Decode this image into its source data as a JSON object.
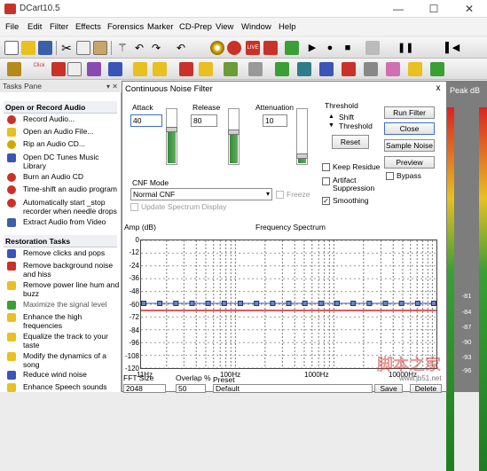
{
  "window": {
    "title": "DCart10.5",
    "minimize": "—",
    "maximize": "☐",
    "close": "✕"
  },
  "menu": [
    "File",
    "Edit",
    "Filter",
    "Effects",
    "Forensics",
    "Marker",
    "CD-Prep",
    "View",
    "Window",
    "Help"
  ],
  "toolbar1_icons": [
    "new-icon",
    "open-icon",
    "save-icon",
    "cut-icon",
    "copy-icon",
    "paste-icon",
    "wand-icon",
    "undo-icon",
    "redo-icon",
    "undo-dropdown-icon",
    "cd-icon",
    "record-icon",
    "live-icon",
    "mixer-icon",
    "marker-icon",
    "play-icon",
    "stop-icon",
    "record-dot-icon",
    "loop-icon",
    "pause-icon",
    "skip-start-icon"
  ],
  "toolbar2_icons": [
    "tools-icon",
    "click-icon",
    "filter-icon",
    "spectrum-icon",
    "analyzer-icon",
    "wave-icon",
    "eq-icon",
    "amp-icon",
    "denoise-icon",
    "reverb-icon",
    "midi-icon",
    "pan-icon",
    "normalize-icon",
    "hum-icon",
    "broadband-icon",
    "stats-icon",
    "cd-burn-icon",
    "label-icon",
    "export-icon",
    "wave2-icon"
  ],
  "colors": {
    "accent": "#3b6fc5",
    "meter_green": "#3aa035",
    "noise_line": "#e02222",
    "curve_line": "#3a55b6",
    "icon_red": "#c83228",
    "icon_yellow": "#e8c020"
  },
  "tasks_pane": {
    "title": "Tasks Pane",
    "buttons": "▾ ✕",
    "sections": [
      {
        "heading": "Open or Record Audio",
        "items": [
          {
            "label": "Record Audio...",
            "icon": "record-icon"
          },
          {
            "label": "Open an Audio File...",
            "icon": "folder-icon"
          },
          {
            "label": "Rip an Audio CD...",
            "icon": "cd-rip-icon"
          },
          {
            "label": "Open DC Tunes Music Library",
            "icon": "library-icon"
          },
          {
            "label": "Burn an Audio CD",
            "icon": "cd-burn-icon"
          },
          {
            "label": "Time-shift an audio program",
            "icon": "clock-icon"
          },
          {
            "label": "Automatically start _stop recorder when needle drops",
            "icon": "auto-record-icon"
          },
          {
            "label": "Extract Audio from Video",
            "icon": "video-icon"
          }
        ]
      },
      {
        "heading": "Restoration Tasks",
        "items": [
          {
            "label": "Remove clicks and pops",
            "icon": "wave-icon"
          },
          {
            "label": "Remove background noise and hiss",
            "icon": "filter-icon"
          },
          {
            "label": "Remove power line hum and buzz",
            "icon": "hum-icon"
          },
          {
            "label": "Maximize the signal level",
            "icon": "maximize-icon"
          },
          {
            "label": "Enhance the high frequencies",
            "icon": "eq-icon"
          },
          {
            "label": "Equalize the track to your taste",
            "icon": "equalizer-icon"
          },
          {
            "label": "Modify the dynamics of a song",
            "icon": "dynamics-icon"
          },
          {
            "label": "Reduce wind noise",
            "icon": "wind-icon"
          },
          {
            "label": "Enhance Speech sounds",
            "icon": "speech-icon"
          }
        ]
      }
    ]
  },
  "peak_meter": {
    "title": "Peak dB",
    "scale": [
      "-81",
      "-84",
      "-87",
      "-90",
      "-93",
      "-96"
    ]
  },
  "dialog": {
    "title": "Continuous Noise Filter",
    "close": "x",
    "attack": {
      "label": "Attack",
      "value": "40"
    },
    "release": {
      "label": "Release",
      "value": "80"
    },
    "attenuation": {
      "label": "Attenuation",
      "value": "10"
    },
    "threshold": {
      "label": "Threshold",
      "shift": "Shift",
      "threshold": "Threshold",
      "reset": "Reset"
    },
    "buttons": {
      "run_filter": "Run Filter",
      "close": "Close",
      "sample_noise": "Sample Noise",
      "preview": "Preview"
    },
    "bypass": {
      "label": "Bypass",
      "checked": false
    },
    "keep_residue": {
      "label": "Keep Residue",
      "checked": false
    },
    "artifact_suppression": {
      "label": "Artifact Suppression",
      "checked": false
    },
    "smoothing": {
      "label": "Smoothing",
      "checked": true
    },
    "cnf_mode": {
      "label": "CNF Mode",
      "value": "Normal CNF"
    },
    "freeze": {
      "label": "Freeze",
      "checked": false
    },
    "update_spectrum": {
      "label": "Update Spectrum Display",
      "checked": false
    },
    "spectrum": {
      "y_label": "Amp (dB)",
      "title": "Frequency Spectrum",
      "y_ticks": [
        "0",
        "-12",
        "-24",
        "-36",
        "-48",
        "-60",
        "-72",
        "-84",
        "-96",
        "-108",
        "-120"
      ],
      "x_ticks": [
        "11Hz",
        "100Hz",
        "1000Hz",
        "10000Hz"
      ]
    },
    "fft_size": {
      "label": "FFT Size",
      "value": "2048"
    },
    "overlap": {
      "label": "Overlap %",
      "value": "50"
    },
    "preset": {
      "label": "Preset",
      "value": "Default"
    },
    "save": "Save",
    "delete": "Delete"
  },
  "watermark": {
    "text": "脚本之家",
    "url": "www.jb51.net"
  }
}
